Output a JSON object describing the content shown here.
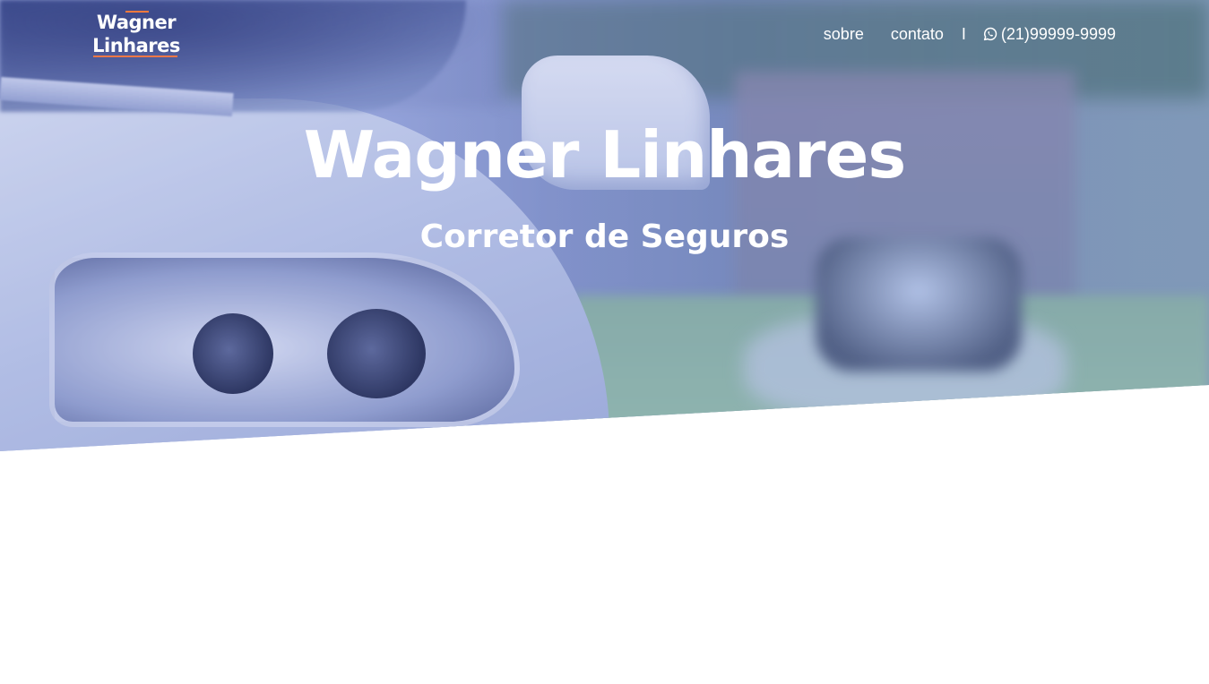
{
  "header": {
    "logo_line1": "Wagner",
    "logo_line2": "Linhares",
    "nav": {
      "about_label": "sobre",
      "contact_label": "contato",
      "separator": "I",
      "phone_icon": "whatsapp-icon",
      "phone_label": "(21)99999-9999"
    }
  },
  "hero": {
    "title": "Wagner Linhares",
    "subtitle": "Corretor de Seguros",
    "background": "car-headlight-photo",
    "overlay_color": "#6a7dcd",
    "accent_color": "#ff7a3d"
  }
}
